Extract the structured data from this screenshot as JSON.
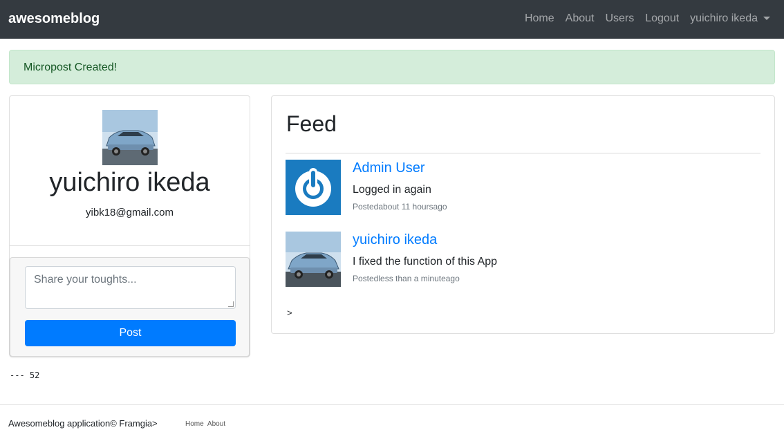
{
  "navbar": {
    "brand": "awesomeblog",
    "links": [
      "Home",
      "About",
      "Users",
      "Logout"
    ],
    "user_menu": "yuichiro ikeda"
  },
  "alert": {
    "message": "Micropost Created!",
    "color": "#d4edda"
  },
  "profile": {
    "name": "yuichiro ikeda",
    "email": "yibk18@gmail.com",
    "avatar_icon": "car-photo-avatar"
  },
  "micropost_form": {
    "placeholder": "Share your toughts...",
    "submit_label": "Post"
  },
  "debug": "--- 52",
  "feed": {
    "title": "Feed",
    "items": [
      {
        "author": "Admin User",
        "content": "Logged in again",
        "time": "Postedabout 11 hoursago",
        "avatar_icon": "power-logo-avatar"
      },
      {
        "author": "yuichiro ikeda",
        "content": "I fixed the function of this App",
        "time": "Postedless than a minuteago",
        "avatar_icon": "car-photo-avatar"
      }
    ],
    "pager": ">"
  },
  "footer": {
    "text": "Awesomeblog application© Framgia>",
    "links": [
      "Home",
      "About"
    ]
  },
  "colors": {
    "navbar": "#343a40",
    "primary": "#007bff",
    "alert_bg": "#d4edda",
    "alert_text": "#155724"
  }
}
